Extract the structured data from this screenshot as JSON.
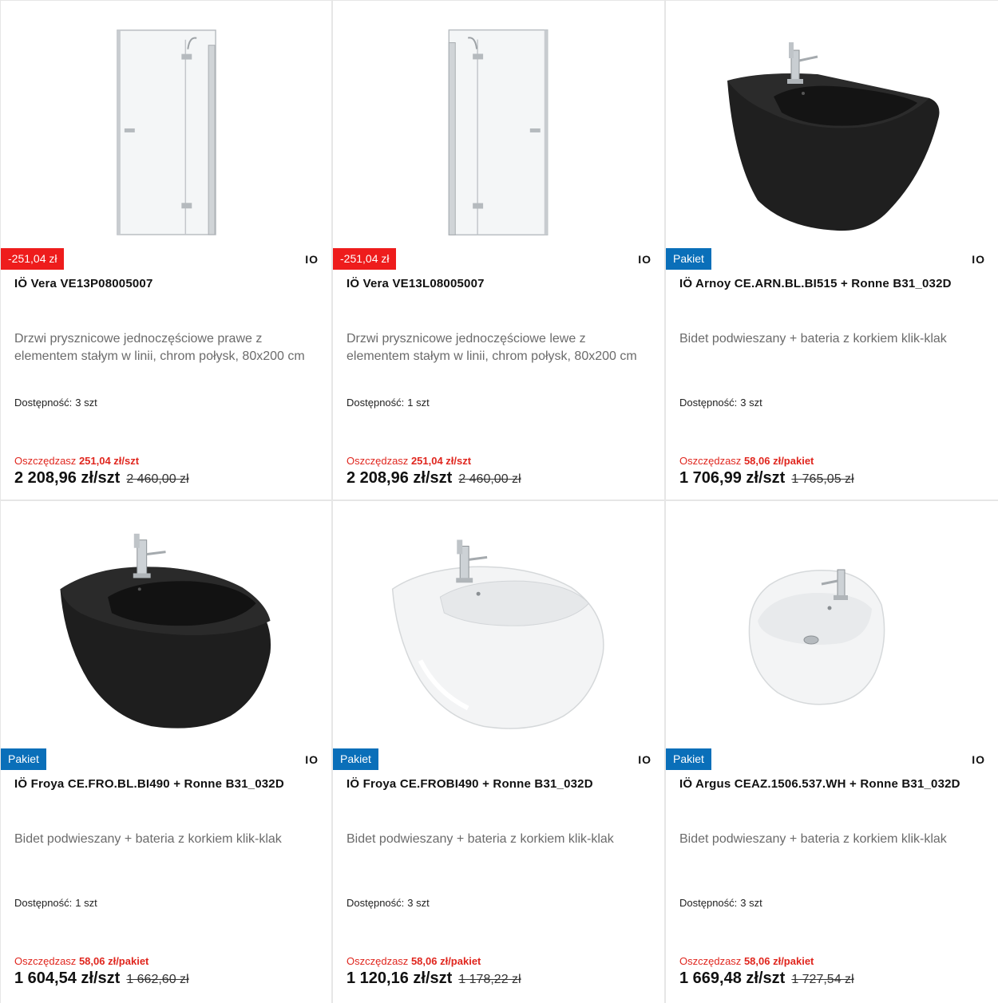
{
  "products": [
    {
      "badge": "-251,04 zł",
      "badge_type": "discount",
      "brand_mark": "IO",
      "title": "IÖ Vera VE13P08005007",
      "description": "Drzwi prysznicowe jednoczęściowe prawe z elementem stałym w linii, chrom połysk, 80x200 cm",
      "availability_label": "Dostępność:",
      "availability_value": "3 szt",
      "savings_label": "Oszczędzasz",
      "savings_amount": "251,04 zł/szt",
      "price": "2 208,96 zł/szt",
      "old_price": "2 460,00 zł",
      "image": "shower-door-right"
    },
    {
      "badge": "-251,04 zł",
      "badge_type": "discount",
      "brand_mark": "IO",
      "title": "IÖ Vera VE13L08005007",
      "description": "Drzwi prysznicowe jednoczęściowe lewe z elementem stałym w linii, chrom połysk, 80x200 cm",
      "availability_label": "Dostępność:",
      "availability_value": "1 szt",
      "savings_label": "Oszczędzasz",
      "savings_amount": "251,04 zł/szt",
      "price": "2 208,96 zł/szt",
      "old_price": "2 460,00 zł",
      "image": "shower-door-left"
    },
    {
      "badge": "Pakiet",
      "badge_type": "pakiet",
      "brand_mark": "IO",
      "title": "IÖ Arnoy CE.ARN.BL.BI515 + Ronne B31_032D",
      "description": "Bidet podwieszany + bateria z korkiem klik-klak",
      "availability_label": "Dostępność:",
      "availability_value": "3 szt",
      "savings_label": "Oszczędzasz",
      "savings_amount": "58,06 zł/pakiet",
      "price": "1 706,99 zł/szt",
      "old_price": "1 765,05 zł",
      "image": "bidet-square-black"
    },
    {
      "badge": "Pakiet",
      "badge_type": "pakiet",
      "brand_mark": "IO",
      "title": "IÖ Froya CE.FRO.BL.BI490 + Ronne B31_032D",
      "description": "Bidet podwieszany + bateria z korkiem klik-klak",
      "availability_label": "Dostępność:",
      "availability_value": "1 szt",
      "savings_label": "Oszczędzasz",
      "savings_amount": "58,06 zł/pakiet",
      "price": "1 604,54 zł/szt",
      "old_price": "1 662,60 zł",
      "image": "bidet-round-black"
    },
    {
      "badge": "Pakiet",
      "badge_type": "pakiet",
      "brand_mark": "IO",
      "title": "IÖ Froya CE.FROBI490 + Ronne B31_032D",
      "description": "Bidet podwieszany + bateria z korkiem klik-klak",
      "availability_label": "Dostępność:",
      "availability_value": "3 szt",
      "savings_label": "Oszczędzasz",
      "savings_amount": "58,06 zł/pakiet",
      "price": "1 120,16 zł/szt",
      "old_price": "1 178,22 zł",
      "image": "bidet-round-white"
    },
    {
      "badge": "Pakiet",
      "badge_type": "pakiet",
      "brand_mark": "IO",
      "title": "IÖ Argus CEAZ.1506.537.WH + Ronne B31_032D",
      "description": "Bidet podwieszany + bateria z korkiem klik-klak",
      "availability_label": "Dostępność:",
      "availability_value": "3 szt",
      "savings_label": "Oszczędzasz",
      "savings_amount": "58,06 zł/pakiet",
      "price": "1 669,48 zł/szt",
      "old_price": "1 727,54 zł",
      "image": "bidet-oval-white"
    }
  ],
  "colors": {
    "discount_badge": "#ee1c1c",
    "pakiet_badge": "#0a6fb9",
    "savings_text": "#e0261e"
  }
}
